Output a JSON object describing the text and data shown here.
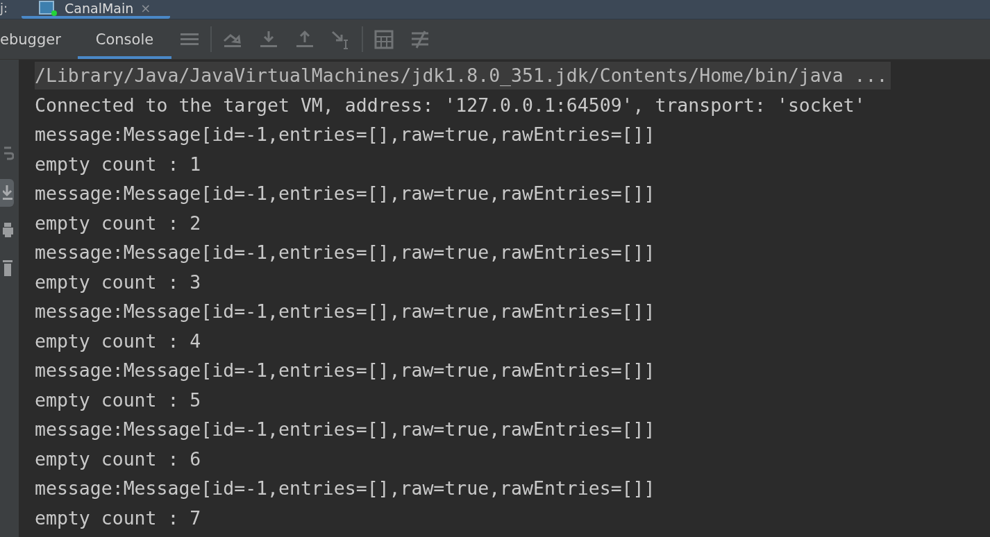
{
  "run_tabs": {
    "left_label": "j:",
    "tabs": [
      {
        "label": "CanalMain",
        "selected": true,
        "close_glyph": "×"
      }
    ]
  },
  "tool_tabs": [
    {
      "label": "ebugger",
      "selected": false
    },
    {
      "label": "Console",
      "selected": true
    }
  ],
  "gutter": {
    "soft_wrap_on": false,
    "scroll_to_end_on": true
  },
  "console_lines": [
    {
      "kind": "command",
      "text": "/Library/Java/JavaVirtualMachines/jdk1.8.0_351.jdk/Contents/Home/bin/java ..."
    },
    {
      "kind": "output",
      "text": "Connected to the target VM, address: '127.0.0.1:64509', transport: 'socket'"
    },
    {
      "kind": "output",
      "text": "message:Message[id=-1,entries=[],raw=true,rawEntries=[]]"
    },
    {
      "kind": "output",
      "text": "empty count : 1"
    },
    {
      "kind": "output",
      "text": "message:Message[id=-1,entries=[],raw=true,rawEntries=[]]"
    },
    {
      "kind": "output",
      "text": "empty count : 2"
    },
    {
      "kind": "output",
      "text": "message:Message[id=-1,entries=[],raw=true,rawEntries=[]]"
    },
    {
      "kind": "output",
      "text": "empty count : 3"
    },
    {
      "kind": "output",
      "text": "message:Message[id=-1,entries=[],raw=true,rawEntries=[]]"
    },
    {
      "kind": "output",
      "text": "empty count : 4"
    },
    {
      "kind": "output",
      "text": "message:Message[id=-1,entries=[],raw=true,rawEntries=[]]"
    },
    {
      "kind": "output",
      "text": "empty count : 5"
    },
    {
      "kind": "output",
      "text": "message:Message[id=-1,entries=[],raw=true,rawEntries=[]]"
    },
    {
      "kind": "output",
      "text": "empty count : 6"
    },
    {
      "kind": "output",
      "text": "message:Message[id=-1,entries=[],raw=true,rawEntries=[]]"
    },
    {
      "kind": "output",
      "text": "empty count : 7"
    }
  ]
}
